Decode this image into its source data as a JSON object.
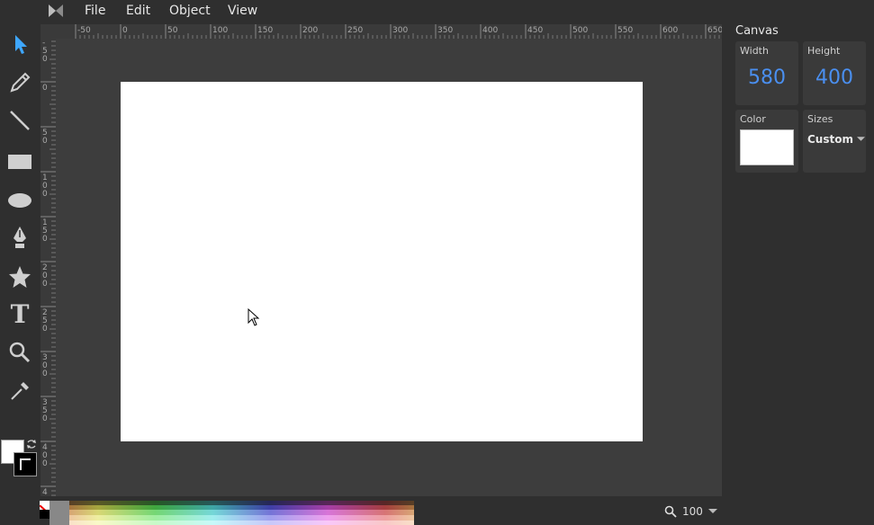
{
  "menu": {
    "items": [
      "File",
      "Edit",
      "Object",
      "View"
    ]
  },
  "toolbar": {
    "tools": [
      {
        "name": "select-tool",
        "icon": "arrow-pointer-icon",
        "active": true
      },
      {
        "name": "pencil-tool",
        "icon": "pencil-icon"
      },
      {
        "name": "line-tool",
        "icon": "line-icon"
      },
      {
        "name": "rectangle-tool",
        "icon": "rectangle-icon"
      },
      {
        "name": "ellipse-tool",
        "icon": "ellipse-icon"
      },
      {
        "name": "pen-tool",
        "icon": "pen-nib-icon"
      },
      {
        "name": "star-tool",
        "icon": "star-icon"
      },
      {
        "name": "text-tool",
        "icon": "text-icon"
      },
      {
        "name": "zoom-tool",
        "icon": "magnifier-icon"
      },
      {
        "name": "eyedropper-tool",
        "icon": "eyedropper-icon"
      }
    ],
    "fill_color": "#ffffff",
    "stroke_color": "#000000"
  },
  "rulers": {
    "top_labels": [
      "-50",
      "0",
      "50",
      "100",
      "150",
      "200",
      "250",
      "300",
      "350",
      "400",
      "450",
      "500",
      "550",
      "600",
      "650"
    ],
    "left_labels": [
      "-50",
      "0",
      "50",
      "100",
      "150",
      "200",
      "250",
      "300",
      "350",
      "400",
      "4"
    ]
  },
  "canvas": {
    "background": "#ffffff"
  },
  "zoom": {
    "value": "100"
  },
  "panel": {
    "title": "Canvas",
    "width_label": "Width",
    "width_value": "580",
    "height_label": "Height",
    "height_value": "400",
    "color_label": "Color",
    "color_value": "#ffffff",
    "sizes_label": "Sizes",
    "sizes_value": "Custom"
  },
  "colors": {
    "accent": "#4a8ff0",
    "active_tool": "#3ea7ff",
    "icon": "#cfcfcf",
    "background": "#2f2f2f",
    "workspace": "#3d3d3d"
  }
}
